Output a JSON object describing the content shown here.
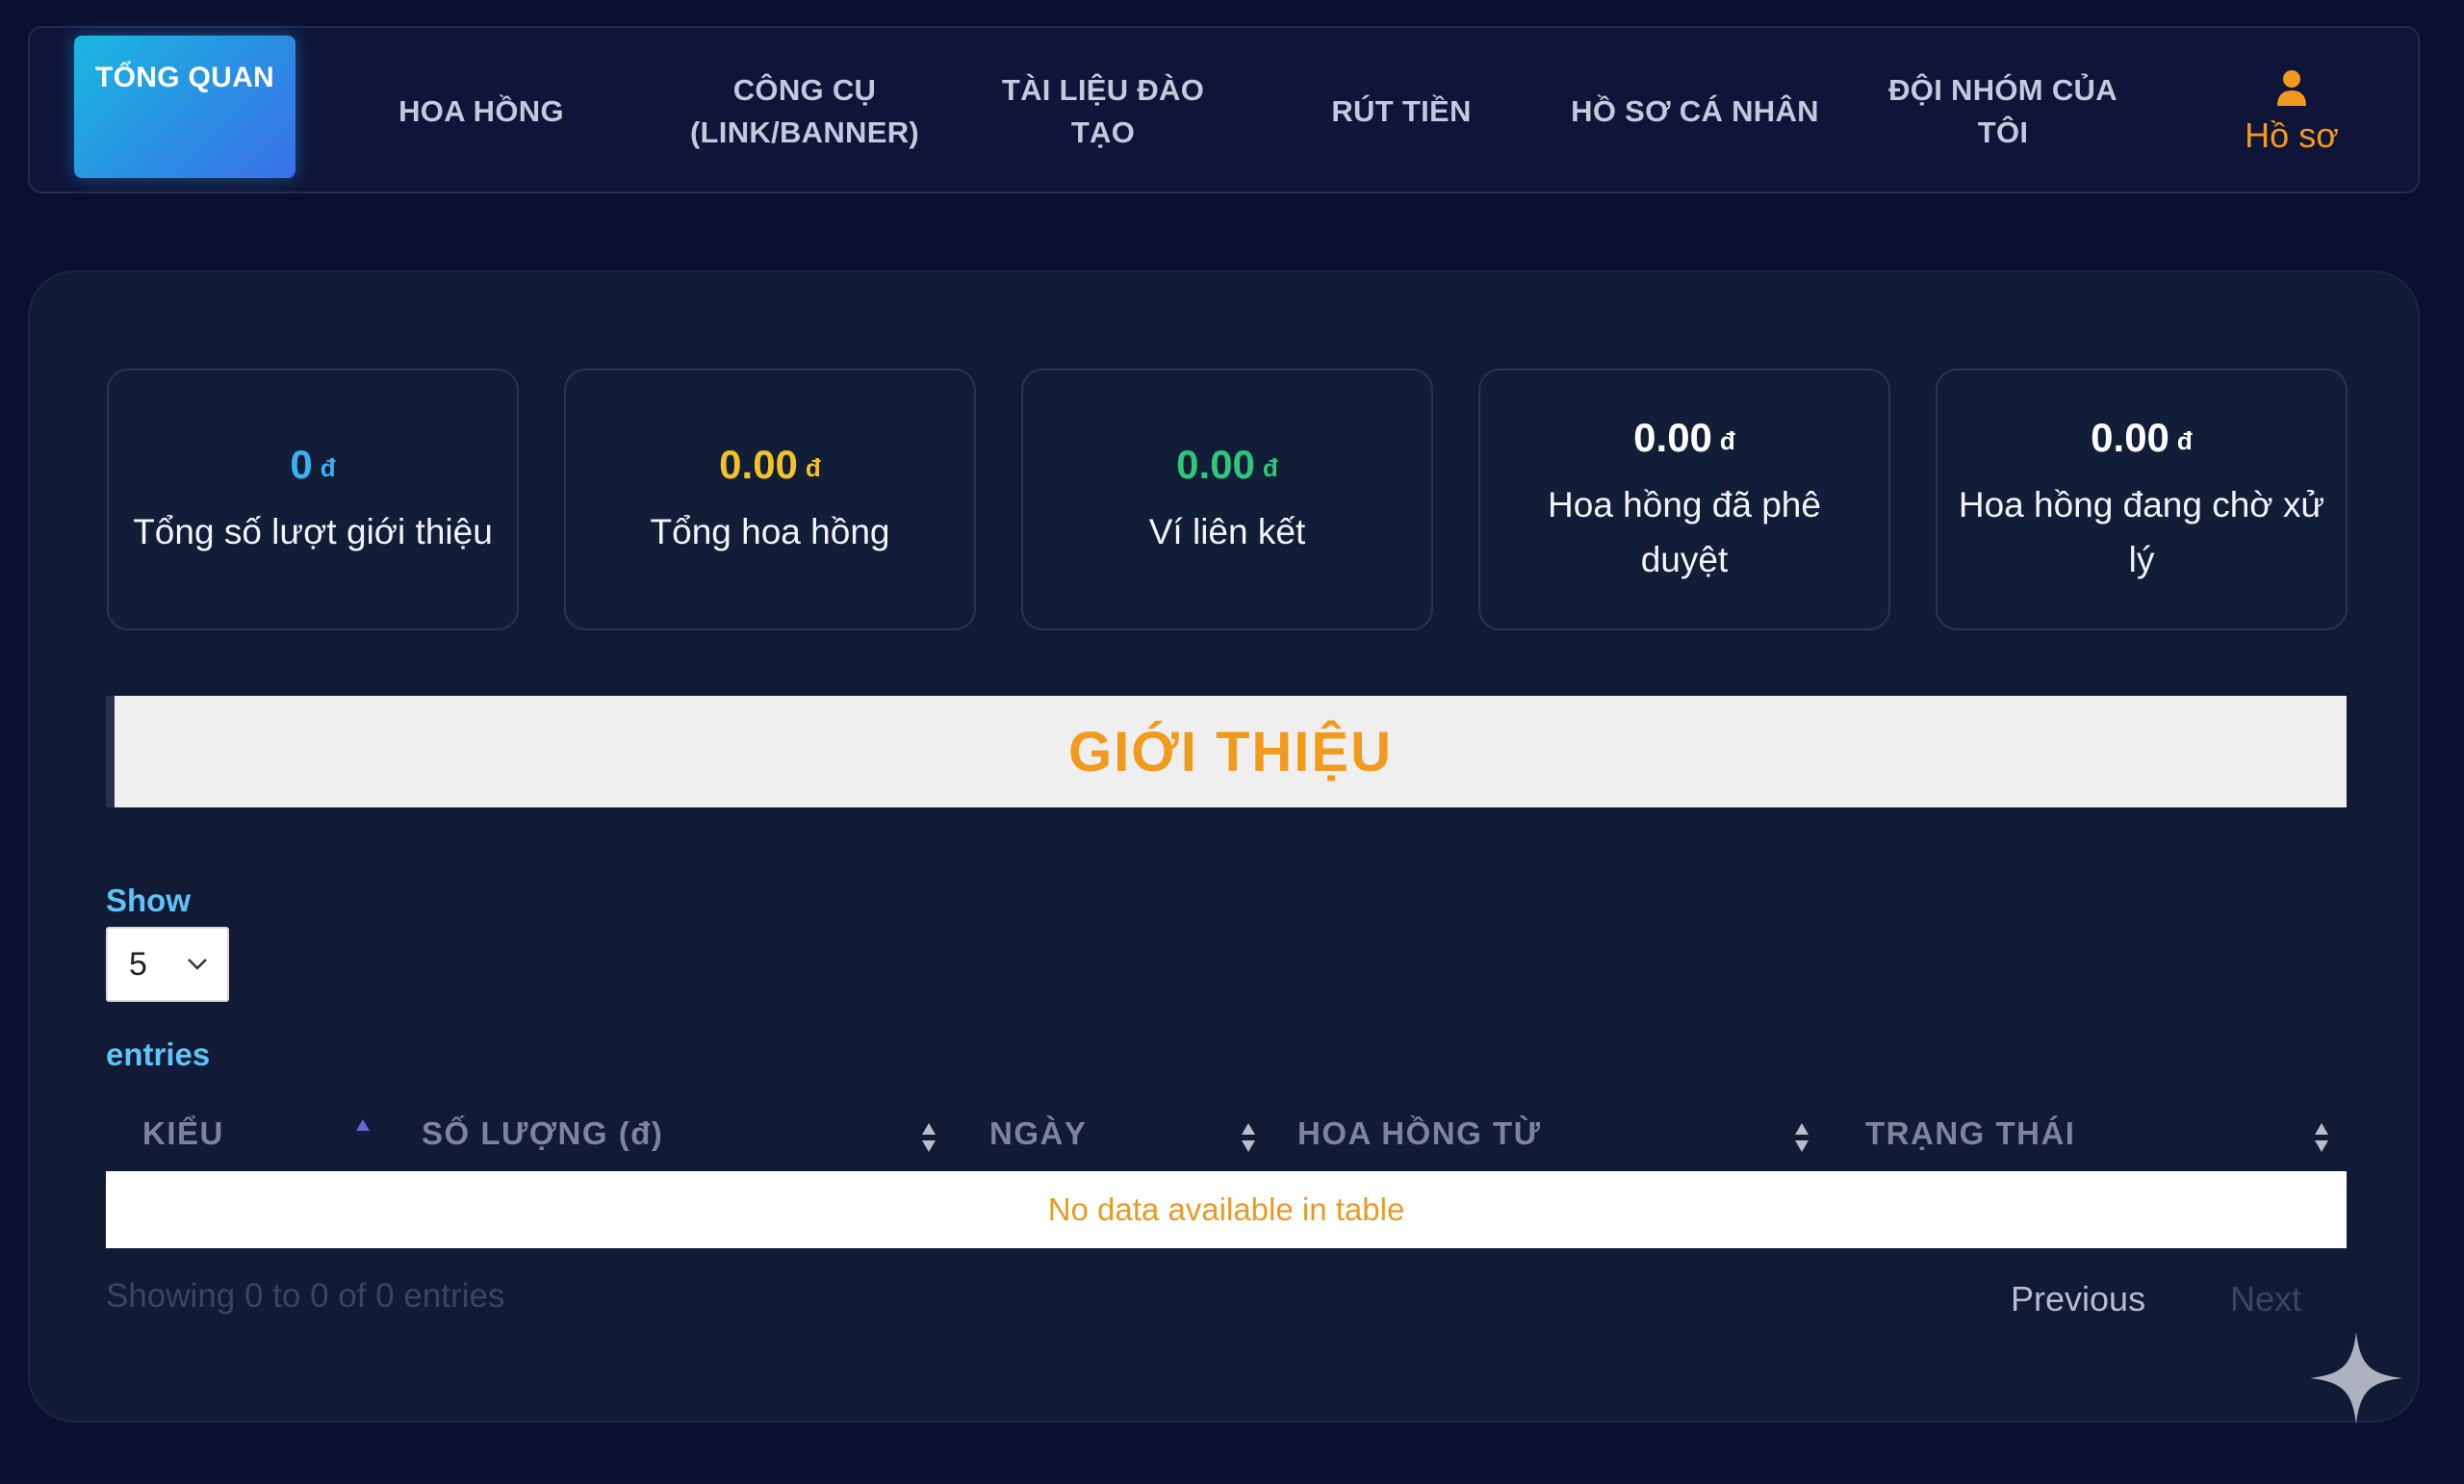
{
  "nav": {
    "items": [
      {
        "label": "TỔNG QUAN"
      },
      {
        "label": "HOA HỒNG"
      },
      {
        "label": "CÔNG CỤ\n(LINK/BANNER)"
      },
      {
        "label": "TÀI LIỆU ĐÀO\nTẠO"
      },
      {
        "label": "RÚT TIỀN"
      },
      {
        "label": "HỒ SƠ CÁ NHÂN"
      },
      {
        "label": "ĐỘI NHÓM CỦA\nTÔI"
      }
    ],
    "profile_label": "Hồ sơ",
    "profile_icon": "user-icon"
  },
  "stats": [
    {
      "value": "0",
      "currency": "đ",
      "caption": "Tổng số lượt giới thiệu",
      "color": "#3cb0f2"
    },
    {
      "value": "0.00",
      "currency": "đ",
      "caption": "Tổng hoa hồng",
      "color": "#f3c323"
    },
    {
      "value": "0.00",
      "currency": "đ",
      "caption": "Ví liên kết",
      "color": "#2ec77a"
    },
    {
      "value": "0.00",
      "currency": "đ",
      "caption": "Hoa hồng đã phê duyệt",
      "color": "#ffffff"
    },
    {
      "value": "0.00",
      "currency": "đ",
      "caption": "Hoa hồng đang chờ xử lý",
      "color": "#ffffff"
    }
  ],
  "section_title": "GIỚI THIỆU",
  "table": {
    "show_label": "Show",
    "page_size": "5",
    "entries_label": "entries",
    "columns": [
      "KIỂU",
      "SỐ LƯỢNG (đ)",
      "NGÀY",
      "HOA HỒNG TỪ",
      "TRẠNG THÁI"
    ],
    "empty_message": "No data available in table",
    "info": "Showing 0 to 0 of 0 entries",
    "previous": "Previous",
    "next": "Next"
  },
  "colors": {
    "background": "#0b1030",
    "accent_orange": "#f29a1d",
    "accent_cyan": "#5fc3f4"
  }
}
